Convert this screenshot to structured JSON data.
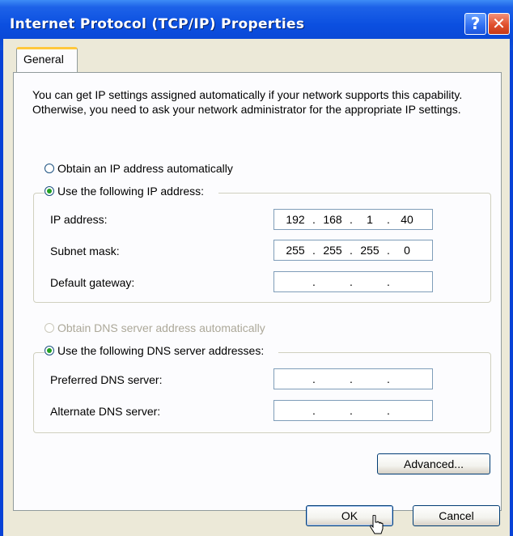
{
  "window": {
    "title": "Internet Protocol (TCP/IP) Properties",
    "help_label": "?",
    "close_label": "✕"
  },
  "tab": {
    "label": "General"
  },
  "description": "You can get IP settings assigned automatically if your network supports this capability. Otherwise, you need to ask your network administrator for the appropriate IP settings.",
  "ip_mode": {
    "auto_label": "Obtain an IP address automatically",
    "manual_label": "Use the following IP address:",
    "selected": "manual"
  },
  "ip_fields": {
    "ip_label": "IP address:",
    "ip_value": [
      "192",
      "168",
      "1",
      "40"
    ],
    "mask_label": "Subnet mask:",
    "mask_value": [
      "255",
      "255",
      "255",
      "0"
    ],
    "gateway_label": "Default gateway:",
    "gateway_value": [
      "",
      "",
      "",
      ""
    ]
  },
  "dns_mode": {
    "auto_label": "Obtain DNS server address automatically",
    "manual_label": "Use the following DNS server addresses:",
    "selected": "manual",
    "auto_disabled": true
  },
  "dns_fields": {
    "preferred_label": "Preferred DNS server:",
    "preferred_value": [
      "",
      "",
      "",
      ""
    ],
    "alternate_label": "Alternate DNS server:",
    "alternate_value": [
      "",
      "",
      "",
      ""
    ]
  },
  "buttons": {
    "advanced": "Advanced...",
    "ok": "OK",
    "cancel": "Cancel"
  },
  "colors": {
    "titlebar": "#0b4fe0",
    "dialog_bg": "#ece9d8",
    "radio_selected": "#21a121",
    "close_button": "#e0502d"
  }
}
